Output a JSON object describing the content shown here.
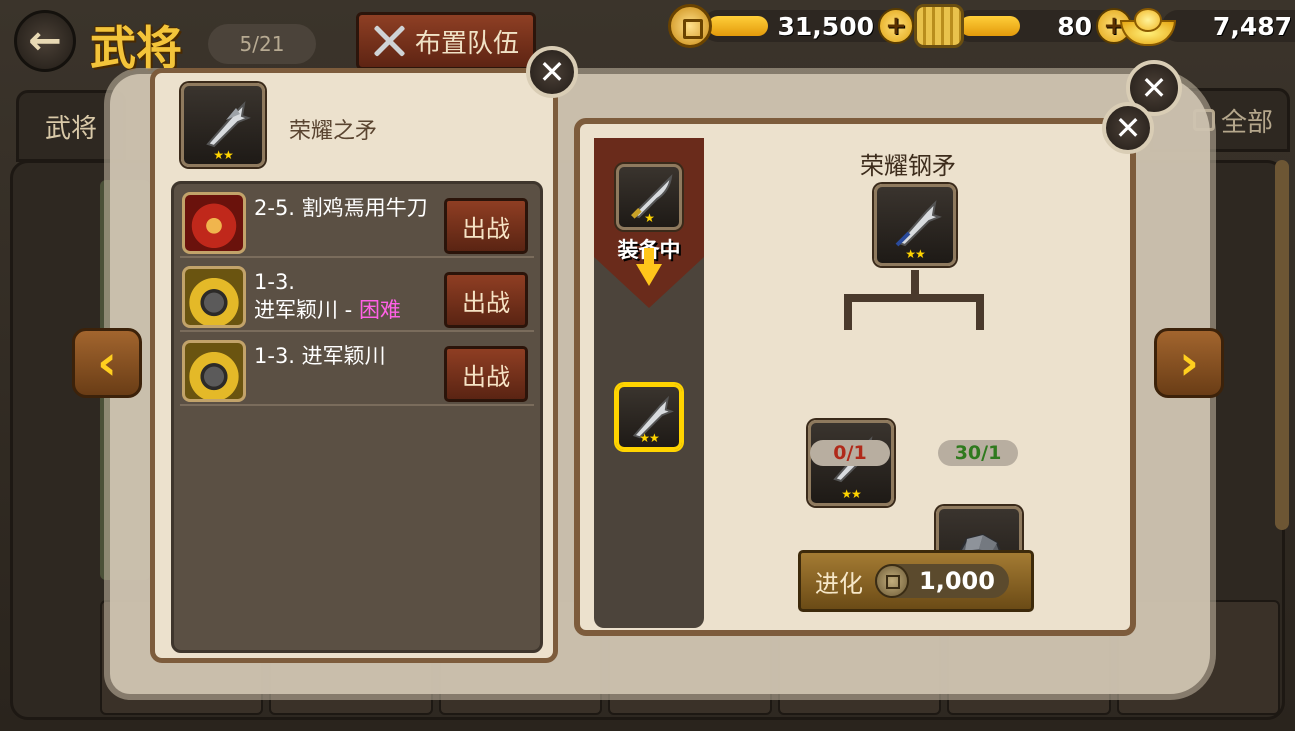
{
  "topbar": {
    "title": "武将",
    "counter": "5/21",
    "team_button_label": "布置队伍",
    "currencies": [
      {
        "icon": "coin-icon",
        "value": "31,500"
      },
      {
        "icon": "scroll-icon",
        "value": "80"
      },
      {
        "icon": "gold-ingot-icon",
        "value": "7,487"
      }
    ],
    "plus_label": "+"
  },
  "background": {
    "left_tab_label": "武将",
    "right_tab_label": "全部"
  },
  "left_popup": {
    "item_name": "荣耀之矛",
    "item_stars": "★★",
    "stages": [
      {
        "line1": "2-5. 割鸡焉用牛刀",
        "line2": "",
        "hard_tag": "",
        "button": "出战",
        "avatar": "red-general"
      },
      {
        "line1": "1-3.",
        "line2": "进军颖川 - ",
        "hard_tag": "困难",
        "button": "出战",
        "avatar": "yellow-turban"
      },
      {
        "line1": "1-3. 进军颖川",
        "line2": "",
        "hard_tag": "",
        "button": "出战",
        "avatar": "yellow-turban"
      }
    ]
  },
  "right_popup": {
    "equipped_label": "装备中",
    "result_name": "荣耀钢矛",
    "result_stars": "★★",
    "equipped_stars": "★",
    "selected_stars": "★★",
    "materials": [
      {
        "name": "spear",
        "stars": "★★",
        "count": "0/1",
        "count_color": "#b02a1a"
      },
      {
        "name": "ore",
        "stars": "",
        "count": "30/1",
        "count_color": "#2f7a1e"
      }
    ],
    "evolve_label": "进化",
    "evolve_cost": "1,000"
  },
  "close_label": "✕"
}
